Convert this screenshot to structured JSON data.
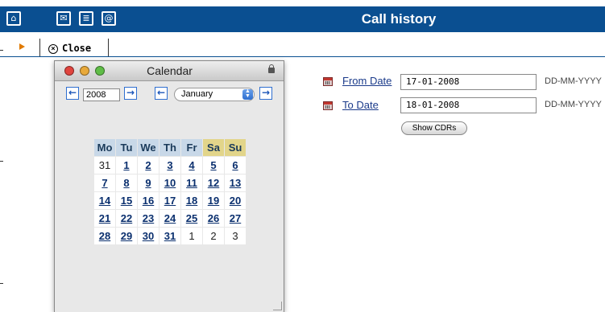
{
  "header": {
    "title": "Call history",
    "icons": [
      "home-icon",
      "mail-icon",
      "list-icon",
      "at-sign-icon"
    ]
  },
  "toolbar": {
    "close_label": "Close"
  },
  "calendar": {
    "title": "Calendar",
    "year": "2008",
    "month": "January",
    "weekdays": [
      "Mo",
      "Tu",
      "We",
      "Th",
      "Fr",
      "Sa",
      "Su"
    ],
    "weeks": [
      [
        "31",
        "1",
        "2",
        "3",
        "4",
        "5",
        "6"
      ],
      [
        "7",
        "8",
        "9",
        "10",
        "11",
        "12",
        "13"
      ],
      [
        "14",
        "15",
        "16",
        "17",
        "18",
        "19",
        "20"
      ],
      [
        "21",
        "22",
        "23",
        "24",
        "25",
        "26",
        "27"
      ],
      [
        "28",
        "29",
        "30",
        "31",
        "1",
        "2",
        "3"
      ]
    ]
  },
  "form": {
    "from_label": "From Date",
    "from_value": "17-01-2008",
    "from_hint": "DD-MM-YYYY",
    "to_label": "To Date",
    "to_value": "18-01-2008",
    "to_hint": "DD-MM-YYYY",
    "show_button": "Show CDRs"
  },
  "colors": {
    "header_bg": "#0a4f91",
    "weekend_header": "#e2d58a",
    "weekday_header": "#c8d8e8"
  }
}
